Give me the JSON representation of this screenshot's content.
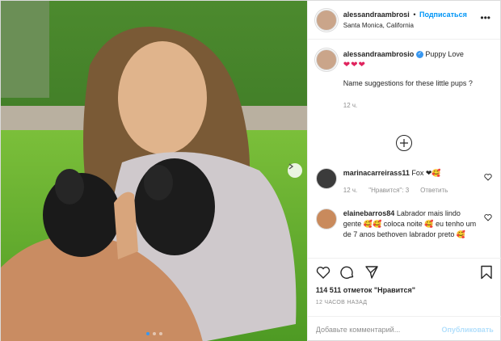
{
  "header": {
    "username": "alessandraambrosi",
    "separator": "•",
    "follow_label": "Подписаться",
    "location": "Santa Monica, California",
    "more_label": "•••"
  },
  "caption": {
    "username": "alessandraambrosio",
    "verified_mark": "✓",
    "title": "Puppy Love",
    "hearts": "❤❤❤",
    "text": "Name suggestions for these little pups ?",
    "time": "12 ч."
  },
  "comments": [
    {
      "username": "marinacarreirass11",
      "text": "Fox",
      "emojis": "❤🥰",
      "time": "12 ч.",
      "likes": "\"Нравится\": 3",
      "reply": "Ответить"
    },
    {
      "username": "elainebarros84",
      "text_1": "Labrador mais lindo gente",
      "text_2": "coloca noite",
      "text_3": "eu tenho um de 7 anos bethoven labrador preto",
      "emoji_1": "🥰🥰",
      "emoji_2": "🥰",
      "emoji_3": "🥰"
    }
  ],
  "likes_text": "114 511 отметок \"Нравится\"",
  "time_ago": "12 ЧАСОВ НАЗАД",
  "add_comment": {
    "placeholder": "Добавьте комментарий...",
    "publish_label": "Опубликовать"
  },
  "colors": {
    "accent": "#0095f6",
    "publish_disabled": "#b2dffc",
    "verified": "#3897f0",
    "heart": "#e0245e"
  },
  "carousel": {
    "slides": 3,
    "active": 1
  }
}
